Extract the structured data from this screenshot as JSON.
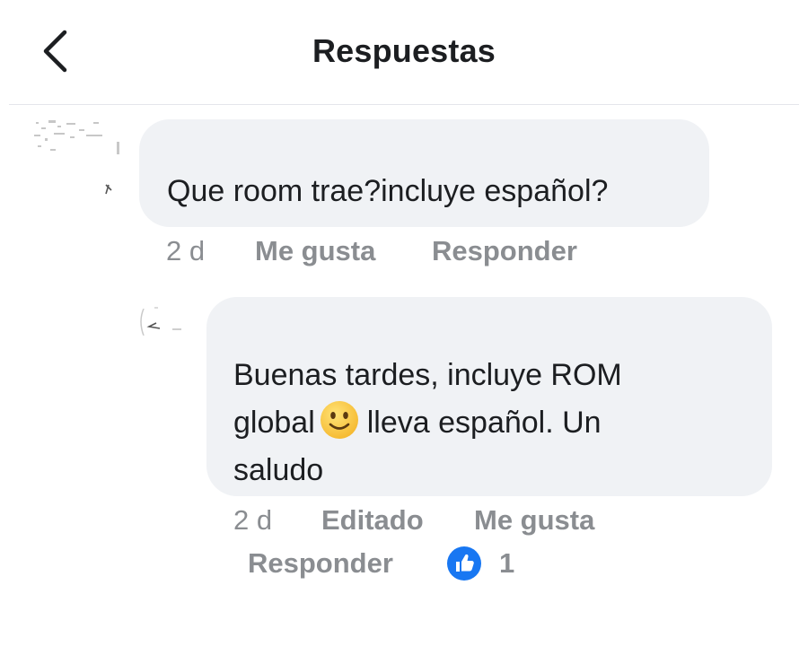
{
  "header": {
    "title": "Respuestas"
  },
  "comment": {
    "text": "Que room trae?incluye español?",
    "time": "2 d",
    "like_label": "Me gusta",
    "reply_label": "Responder"
  },
  "reply": {
    "text_line1": "Buenas tardes, incluye ROM",
    "text_before_emoji": "global",
    "text_after_emoji": "lleva español. Un",
    "text_line3": "saludo",
    "time": "2 d",
    "edited_label": "Editado",
    "like_label": "Me gusta",
    "reply_label": "Responder",
    "reaction_count": "1"
  },
  "colors": {
    "bubble": "#f0f2f5",
    "meta_text": "#8a8d91",
    "like_reaction": "#1877f2",
    "emoji_face": "#f7c93b"
  },
  "icons": {
    "back": "chevron-left-icon",
    "reaction": "thumbs-up-icon",
    "emoji": "slightly-smiling-face"
  }
}
